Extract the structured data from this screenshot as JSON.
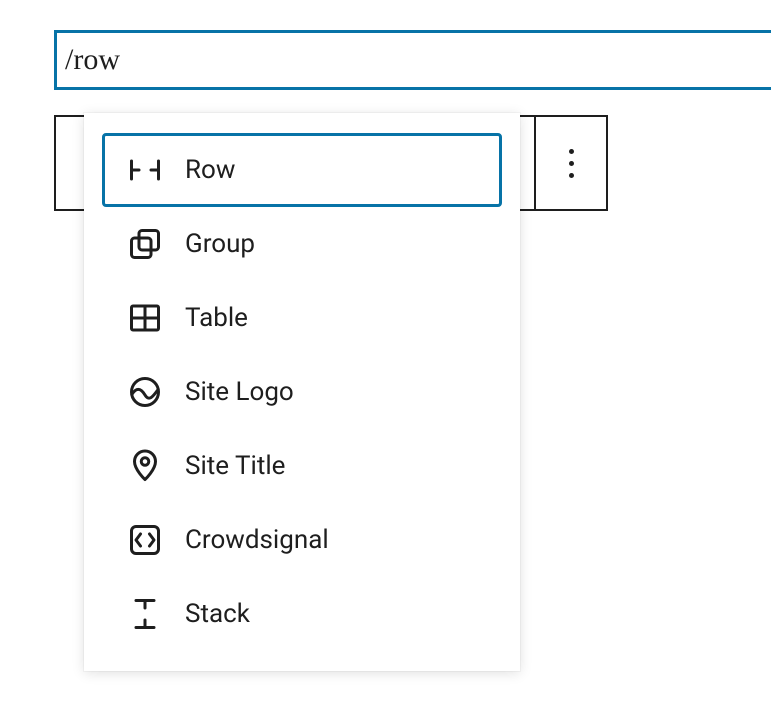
{
  "search": {
    "value": "/row"
  },
  "dropdown": {
    "items": [
      {
        "label": "Row",
        "icon": "row-icon",
        "selected": true
      },
      {
        "label": "Group",
        "icon": "group-icon",
        "selected": false
      },
      {
        "label": "Table",
        "icon": "table-icon",
        "selected": false
      },
      {
        "label": "Site Logo",
        "icon": "site-logo-icon",
        "selected": false
      },
      {
        "label": "Site Title",
        "icon": "site-title-icon",
        "selected": false
      },
      {
        "label": "Crowdsignal",
        "icon": "crowdsignal-icon",
        "selected": false
      },
      {
        "label": "Stack",
        "icon": "stack-icon",
        "selected": false
      }
    ]
  }
}
